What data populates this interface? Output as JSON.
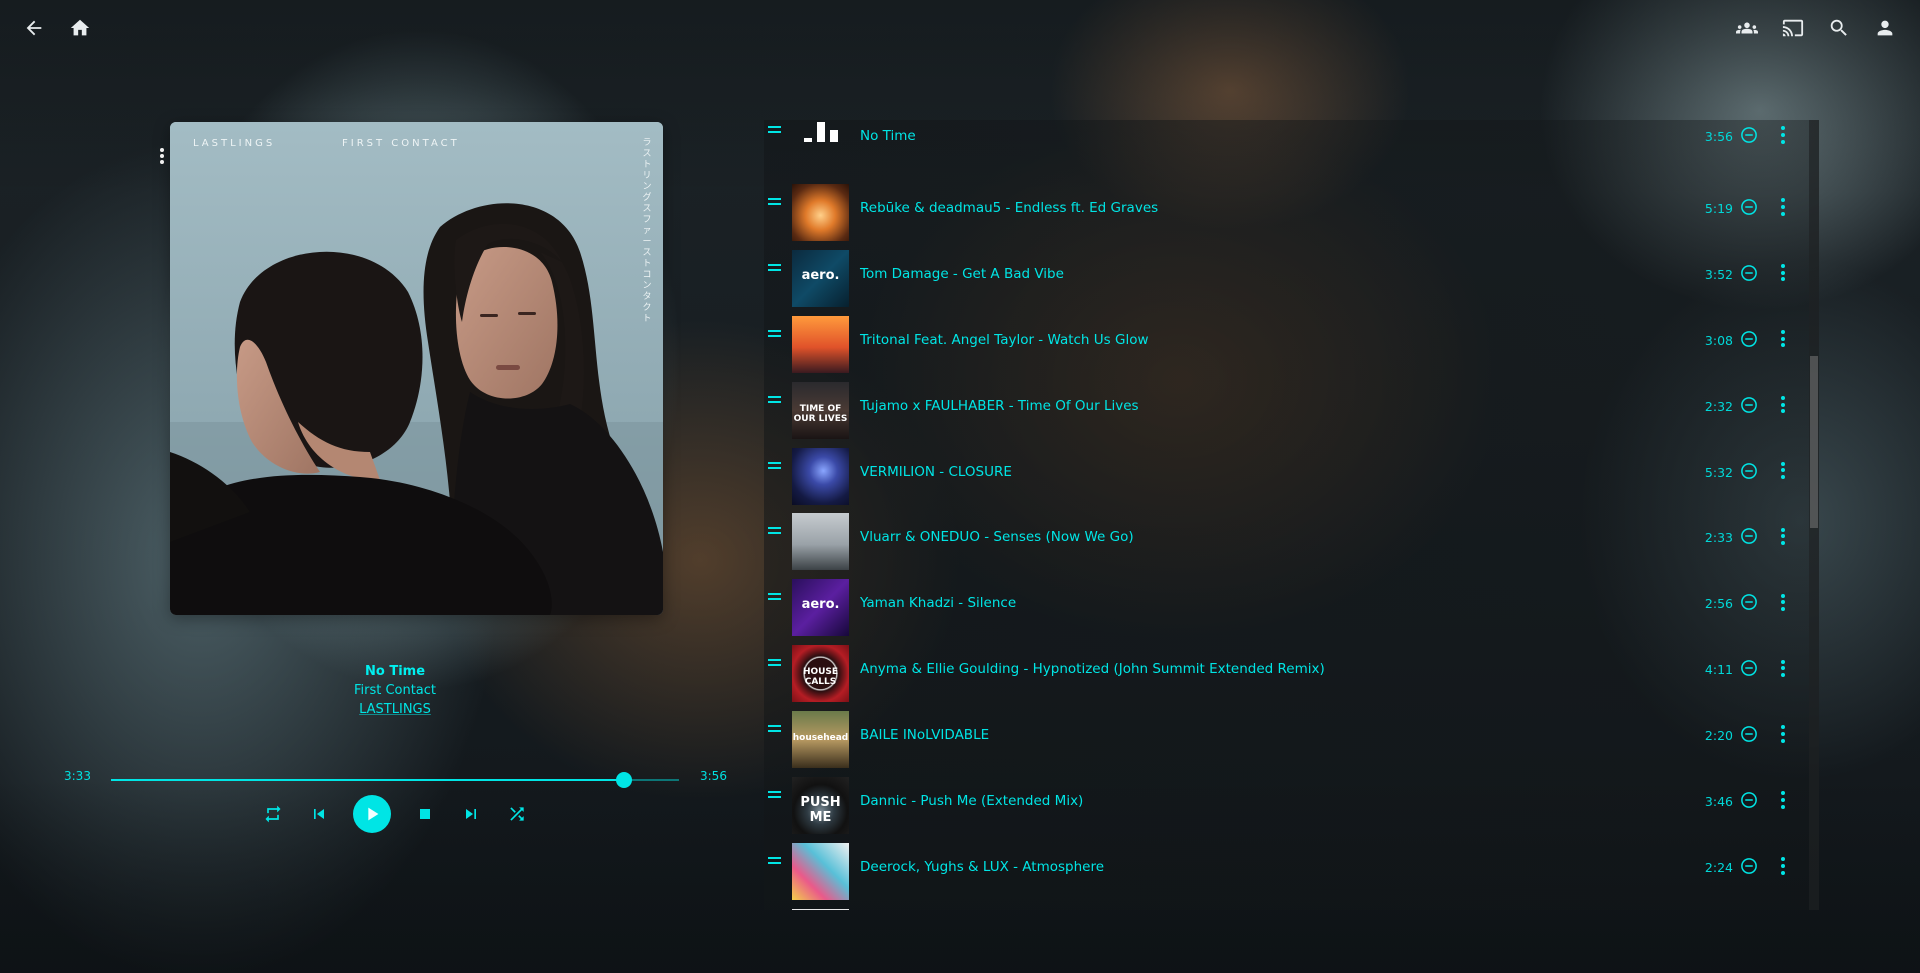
{
  "header": {
    "icons": [
      "arrow-back-icon",
      "home-icon",
      "group-icon",
      "cast-icon",
      "search-icon",
      "account-icon"
    ]
  },
  "album_art": {
    "artist_label": "LASTLINGS",
    "album_label": "FIRST CONTACT",
    "vertical_text": "ラストリングス ファースト コンタクト"
  },
  "now_playing": {
    "title": "No Time",
    "album": "First Contact",
    "artist": "LASTLINGS"
  },
  "progress": {
    "elapsed": "3:33",
    "total": "3:56",
    "fraction": 0.903
  },
  "controls": {
    "icons": [
      "repeat-icon",
      "previous-icon",
      "play-icon",
      "stop-icon",
      "next-icon",
      "shuffle-icon"
    ]
  },
  "queue": {
    "tracks": [
      {
        "title": "No Time",
        "duration": "3:56",
        "thumb": "now-playing-bars"
      },
      {
        "title": "Rebūke & deadmau5 - Endless ft. Ed Graves",
        "duration": "5:19",
        "thumb": "orange-burst"
      },
      {
        "title": "Tom Damage - Get A Bad Vibe",
        "duration": "3:52",
        "thumb": "aero",
        "thumb_text": "aero."
      },
      {
        "title": "Tritonal Feat. Angel Taylor - Watch Us Glow",
        "duration": "3:08",
        "thumb": "triangle-sunset"
      },
      {
        "title": "Tujamo x FAULHABER - Time Of Our Lives",
        "duration": "2:32",
        "thumb": "time-of-our-lives",
        "thumb_text": "TIME OF OUR LIVES"
      },
      {
        "title": "VERMILION - CLOSURE",
        "duration": "5:32",
        "thumb": "night-sky"
      },
      {
        "title": "Vluarr & ONEDUO - Senses (Now We Go)",
        "duration": "2:33",
        "thumb": "beach-grey"
      },
      {
        "title": "Yaman Khadzi - Silence",
        "duration": "2:56",
        "thumb": "aero-purple",
        "thumb_text": "aero."
      },
      {
        "title": "Anyma & Ellie Goulding - Hypnotized (John Summit Extended Remix)",
        "duration": "4:11",
        "thumb": "house-calls",
        "thumb_text": "HOUSE CALLS"
      },
      {
        "title": "BAILE INoLVIDABLE",
        "duration": "2:20",
        "thumb": "househead",
        "thumb_text": "househead"
      },
      {
        "title": "Dannic - Push Me (Extended Mix)",
        "duration": "3:46",
        "thumb": "push-me-speaker",
        "thumb_text": "PUSH ME"
      },
      {
        "title": "Deerock, Yughs & LUX - Atmosphere",
        "duration": "2:24",
        "thumb": "colorful-shapes"
      },
      {
        "title": "",
        "duration": "",
        "thumb": "partial"
      }
    ]
  },
  "colors": {
    "accent": "#00e5e5",
    "header_icon": "#e8ecee",
    "background": "#141a1e"
  }
}
